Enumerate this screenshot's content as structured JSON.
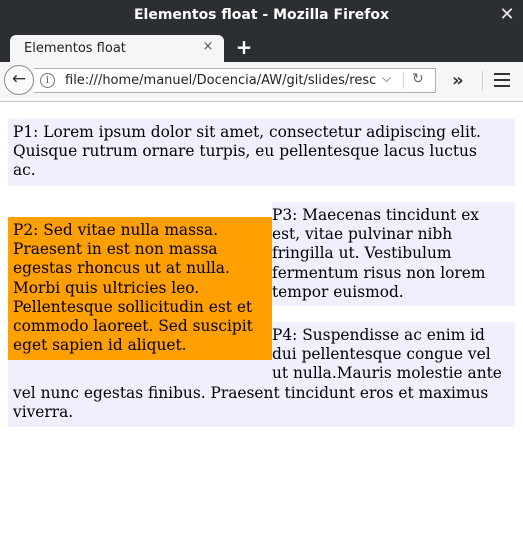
{
  "window": {
    "title": "Elementos float - Mozilla Firefox",
    "close_glyph": "✕"
  },
  "tabs": [
    {
      "label": "Elementos float",
      "close_glyph": "×"
    }
  ],
  "new_tab_glyph": "+",
  "navbar": {
    "back_glyph": "←",
    "info_glyph": "i",
    "url": "file:///home/manuel/Docencia/AW/git/slides/resc",
    "dropdown_glyph": "⌵",
    "reload_glyph": "↻",
    "overflow_glyph": "»"
  },
  "icons": [
    "back-arrow-icon",
    "info-icon",
    "dropdown-icon",
    "reload-icon",
    "overflow-icon",
    "hamburger-menu-icon"
  ],
  "colors": {
    "titlebar": "#2b2e33",
    "paragraph_bg": "#efeffd",
    "floated_bg": "#ff9f00"
  },
  "content": {
    "p1_lines": [
      "P1: Lorem ipsum dolor sit amet, consectetur adipiscing elit.",
      "Quisque rutrum ornare turpis, eu pellentesque lacus luctus",
      "ac."
    ],
    "p2_lines": [
      "P2: Sed vitae nulla massa.",
      "Praesent in est non massa",
      "egestas rhoncus ut at nulla.",
      "Morbi quis ultricies leo.",
      "Pellentesque sollicitudin est et",
      "commodo laoreet. Sed suscipit",
      "eget sapien id aliquet."
    ],
    "p3_lines": [
      "P3: Maecenas tincidunt ex",
      "est, vitae pulvinar nibh",
      "fringilla ut. Vestibulum",
      "fermentum risus non lorem",
      "tempor euismod."
    ],
    "p4_lines_right": [
      "P4: Suspendisse ac enim id",
      "dui pellentesque congue vel",
      "ut nulla.Mauris molestie ante"
    ],
    "p4_lines_full": [
      "vel nunc egestas finibus. Praesent tincidunt eros et maximus",
      "viverra."
    ]
  }
}
